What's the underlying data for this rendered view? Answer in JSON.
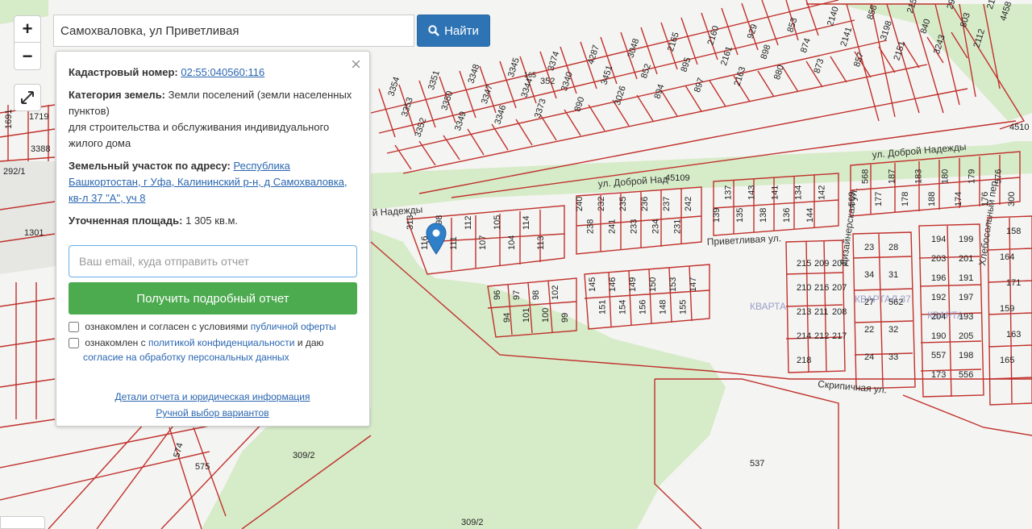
{
  "search": {
    "value": "Самохваловка, ул Приветливая",
    "button_label": "Найти"
  },
  "zoom": {
    "in_label": "+",
    "out_label": "−"
  },
  "panel": {
    "cadastral_label": "Кадастровый номер:",
    "cadastral_value": "02:55:040560:116",
    "category_label": "Категория земель:",
    "category_value": "Земли поселений (земли населенных пунктов)",
    "category_use": "для строительства и обслуживания индивидуального жилого дома",
    "address_label": "Земельный участок по адресу:",
    "address_value": "Республика Башкортостан, г Уфа, Калининский р-н, д Самохваловка, кв-л 37 \"А\", уч 8",
    "area_label": "Уточненная площадь:",
    "area_value": "1 305 кв.м.",
    "email_placeholder": "Ваш email, куда отправить отчет",
    "report_button": "Получить подробный отчет",
    "check1_text": "ознакомлен и согласен с условиями",
    "check1_link": "публичной оферты",
    "check2_text": "ознакомлен с",
    "check2_link1": "политикой конфиденциальности",
    "check2_mid": "и даю",
    "check2_link2": "согласие на обработку персональных данных",
    "link_details": "Детали отчета и юридическая информация",
    "link_manual": "Ручной выбор вариантов"
  },
  "map": {
    "streets": [
      "ул. Доброй Надежды",
      "ул. Доброй Над",
      "й Надежды",
      "Приветливая ул.",
      "Дизайнерская ул.",
      "Хлебосольный пер.",
      "Скрипичная ул."
    ],
    "zones": [
      "КВАРТА",
      "КВАРТАЛ 37",
      "КВАРТА"
    ],
    "big_parcels": [
      "537",
      "575",
      "574",
      "309/2",
      "309/2",
      "45109",
      "4510",
      "352",
      "165"
    ],
    "row_top": [
      "3354",
      "3353",
      "3352",
      "3351",
      "3350",
      "3349",
      "3348",
      "3347",
      "3346",
      "3345",
      "3344",
      "3373",
      "3374",
      "3340",
      "890",
      "4287",
      "3451",
      "3026",
      "3048",
      "852",
      "894",
      "2165",
      "895",
      "897",
      "2160",
      "2161",
      "2163",
      "929",
      "898",
      "880",
      "853",
      "874",
      "873",
      "2140",
      "2141",
      "857",
      "858",
      "3198",
      "2151",
      "2154",
      "840",
      "3243",
      "2983",
      "803",
      "2112",
      "2111",
      "4458"
    ],
    "row_mid": [
      "313",
      "116",
      "298",
      "111",
      "112",
      "107",
      "105",
      "104",
      "114",
      "113",
      "240",
      "238",
      "232",
      "241",
      "235",
      "233",
      "236",
      "234",
      "237",
      "231",
      "242",
      "139",
      "137",
      "135",
      "143",
      "138",
      "141",
      "136",
      "134",
      "144",
      "142",
      "569",
      "568",
      "177",
      "187",
      "178",
      "183",
      "188",
      "180",
      "174",
      "179",
      "176",
      "576",
      "300"
    ],
    "row_low": [
      "96",
      "94",
      "97",
      "101",
      "98",
      "100",
      "102",
      "99",
      "145",
      "151",
      "146",
      "154",
      "149",
      "156",
      "150",
      "148",
      "153",
      "155",
      "147"
    ],
    "row_right": [
      "215",
      "209",
      "206",
      "210",
      "216",
      "207",
      "213",
      "211",
      "208",
      "214",
      "212",
      "217",
      "218",
      "28",
      "23",
      "31",
      "34",
      "562",
      "27",
      "32",
      "22",
      "33",
      "24",
      "199",
      "194",
      "201",
      "203",
      "191",
      "196",
      "197",
      "192",
      "193",
      "204",
      "205",
      "190",
      "198",
      "557",
      "556",
      "173",
      "158",
      "164",
      "171",
      "159",
      "163",
      "165"
    ],
    "left_parcels": [
      "1719",
      "3388",
      "1691",
      "292/1",
      "1301"
    ]
  }
}
